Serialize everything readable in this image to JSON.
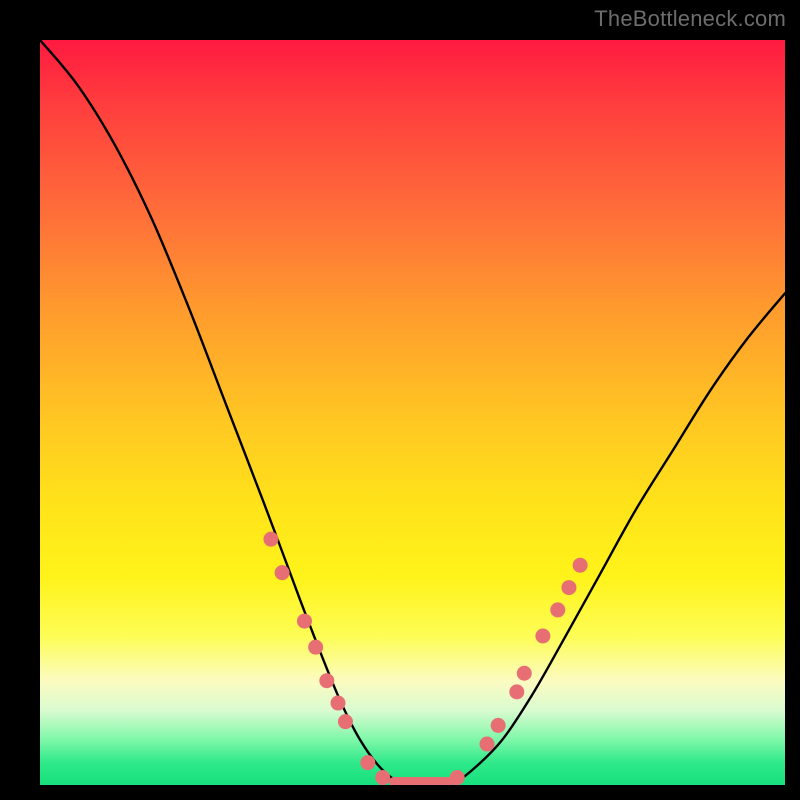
{
  "watermark": "TheBottleneck.com",
  "chart_data": {
    "type": "line",
    "title": "",
    "xlabel": "",
    "ylabel": "",
    "xlim": [
      0,
      100
    ],
    "ylim": [
      0,
      100
    ],
    "series": [
      {
        "name": "bottleneck-curve",
        "x": [
          0,
          5,
          10,
          15,
          20,
          25,
          30,
          33,
          36,
          40,
          43,
          46,
          49,
          52,
          55,
          58,
          62,
          66,
          70,
          75,
          80,
          85,
          90,
          95,
          100
        ],
        "y": [
          100,
          94,
          86,
          76,
          64,
          51,
          38,
          30,
          22,
          12,
          6,
          2,
          0,
          0,
          0,
          2,
          6,
          12,
          19,
          28,
          37,
          45,
          53,
          60,
          66
        ]
      }
    ],
    "markers": {
      "name": "highlight-dots",
      "color": "#e76f74",
      "points": [
        {
          "x": 31.0,
          "y": 33.0
        },
        {
          "x": 32.5,
          "y": 28.5
        },
        {
          "x": 35.5,
          "y": 22.0
        },
        {
          "x": 37.0,
          "y": 18.5
        },
        {
          "x": 38.5,
          "y": 14.0
        },
        {
          "x": 40.0,
          "y": 11.0
        },
        {
          "x": 41.0,
          "y": 8.5
        },
        {
          "x": 44.0,
          "y": 3.0
        },
        {
          "x": 46.0,
          "y": 1.0
        },
        {
          "x": 48.0,
          "y": 0.0
        },
        {
          "x": 50.0,
          "y": 0.0
        },
        {
          "x": 52.0,
          "y": 0.0
        },
        {
          "x": 54.0,
          "y": 0.0
        },
        {
          "x": 56.0,
          "y": 1.0
        },
        {
          "x": 60.0,
          "y": 5.5
        },
        {
          "x": 61.5,
          "y": 8.0
        },
        {
          "x": 64.0,
          "y": 12.5
        },
        {
          "x": 65.0,
          "y": 15.0
        },
        {
          "x": 67.5,
          "y": 20.0
        },
        {
          "x": 69.5,
          "y": 23.5
        },
        {
          "x": 71.0,
          "y": 26.5
        },
        {
          "x": 72.5,
          "y": 29.5
        }
      ]
    },
    "flat_segment": {
      "x0": 47.5,
      "x1": 55.0,
      "y": 0.4,
      "color": "#e76f74",
      "thickness_px": 10
    }
  }
}
